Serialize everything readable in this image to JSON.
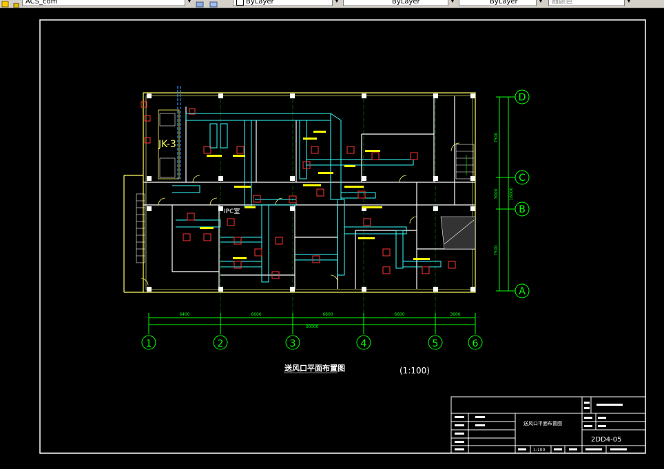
{
  "toolbar": {
    "layer_value": "ACS_com",
    "color_value": "ByLayer",
    "linetype_value": "ByLayer",
    "lineweight_value": "ByLayer",
    "plotstyle_value": "随颜色"
  },
  "drawing": {
    "title": "送风口平面布置图",
    "scale": "(1:100)",
    "unit_label": "JK-3",
    "room_label_ipc": "IPC室",
    "grid_rows": [
      "D",
      "C",
      "B",
      "A"
    ],
    "grid_cols": [
      "1",
      "2",
      "3",
      "4",
      "5",
      "6"
    ],
    "dims_horizontal": [
      "6400",
      "6600",
      "6600",
      "6600",
      "3600"
    ],
    "dim_total": "30000",
    "dims_vertical": [
      "7500",
      "3000",
      "7500"
    ],
    "dim_vertical_sub": "18000"
  },
  "title_block": {
    "drawing_number": "2DD4-05",
    "drawing_name": "送风口平面布置图",
    "scale": "1:100"
  },
  "colors": {
    "background": "#000000",
    "outline": "#ffffff",
    "walls": "#ffff66",
    "grid": "#00ff00",
    "duct": "#33ffff",
    "diffuser": "#ff3333"
  }
}
